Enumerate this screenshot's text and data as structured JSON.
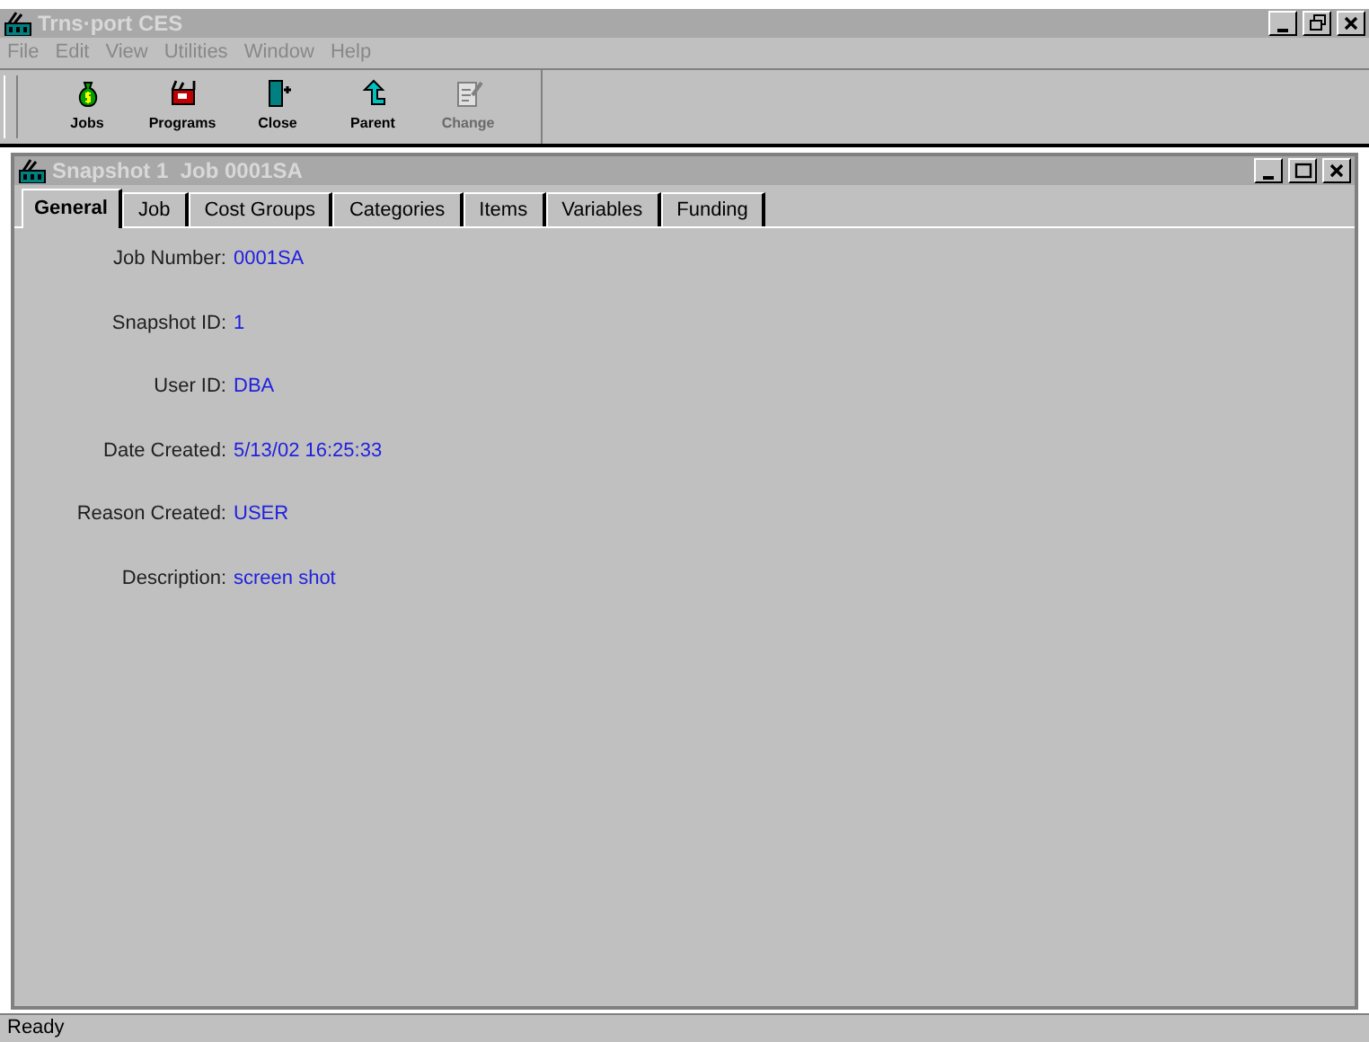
{
  "window": {
    "title": "Trns·port CES"
  },
  "menu": [
    {
      "label": "File",
      "disabled": true
    },
    {
      "label": "Edit",
      "disabled": true
    },
    {
      "label": "View",
      "disabled": true
    },
    {
      "label": "Utilities",
      "disabled": true
    },
    {
      "label": "Window",
      "disabled": true
    },
    {
      "label": "Help",
      "disabled": true
    }
  ],
  "toolbar": [
    {
      "label": "Jobs",
      "kind": "jobs",
      "disabled": false
    },
    {
      "label": "Programs",
      "kind": "programs",
      "disabled": false
    },
    {
      "label": "Close",
      "kind": "close",
      "disabled": false
    },
    {
      "label": "Parent",
      "kind": "parent",
      "disabled": false
    },
    {
      "label": "Change",
      "kind": "change",
      "disabled": true
    }
  ],
  "child_window": {
    "title": "Snapshot 1  Job 0001SA"
  },
  "tabs": [
    {
      "label": "General",
      "selected": true
    },
    {
      "label": "Job",
      "selected": false
    },
    {
      "label": "Cost Groups",
      "selected": false
    },
    {
      "label": "Categories",
      "selected": false
    },
    {
      "label": "Items",
      "selected": false
    },
    {
      "label": "Variables",
      "selected": false
    },
    {
      "label": "Funding",
      "selected": false
    }
  ],
  "fields": [
    {
      "label": "Job Number:",
      "value": "0001SA"
    },
    {
      "label": "Snapshot ID:",
      "value": "1"
    },
    {
      "label": "User ID:",
      "value": "DBA"
    },
    {
      "label": "Date Created:",
      "value": "5/13/02 16:25:33"
    },
    {
      "label": "Reason Created:",
      "value": "USER"
    },
    {
      "label": "Description:",
      "value": "screen shot"
    }
  ],
  "status_bar": {
    "text": "Ready"
  }
}
